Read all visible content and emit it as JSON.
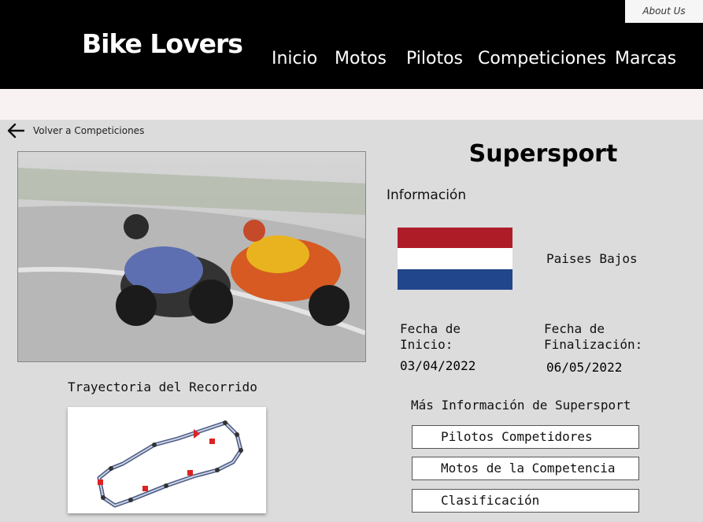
{
  "header": {
    "about": "About Us",
    "logo": "Bike Lovers",
    "nav": [
      "Inicio",
      "Motos",
      "Pilotos",
      "Competiciones",
      "Marcas"
    ]
  },
  "back_link": {
    "label": "Volver a Competiciones",
    "icon": "arrow-left-icon"
  },
  "page": {
    "title": "Supersport",
    "info_label": "Información",
    "country": "Paises Bajos",
    "flag_colors": [
      "#ae1c28",
      "#ffffff",
      "#21468b"
    ],
    "start_label": "Fecha de Inicio:",
    "start_date": "03/04/2022",
    "end_label": "Fecha de Finalización:",
    "end_date": "06/05/2022",
    "track_title": "Trayectoria del Recorrido",
    "more_info": "Más Información de Supersport",
    "buttons": [
      "Pilotos Competidores",
      "Motos de la Competencia",
      "Clasificación"
    ]
  }
}
